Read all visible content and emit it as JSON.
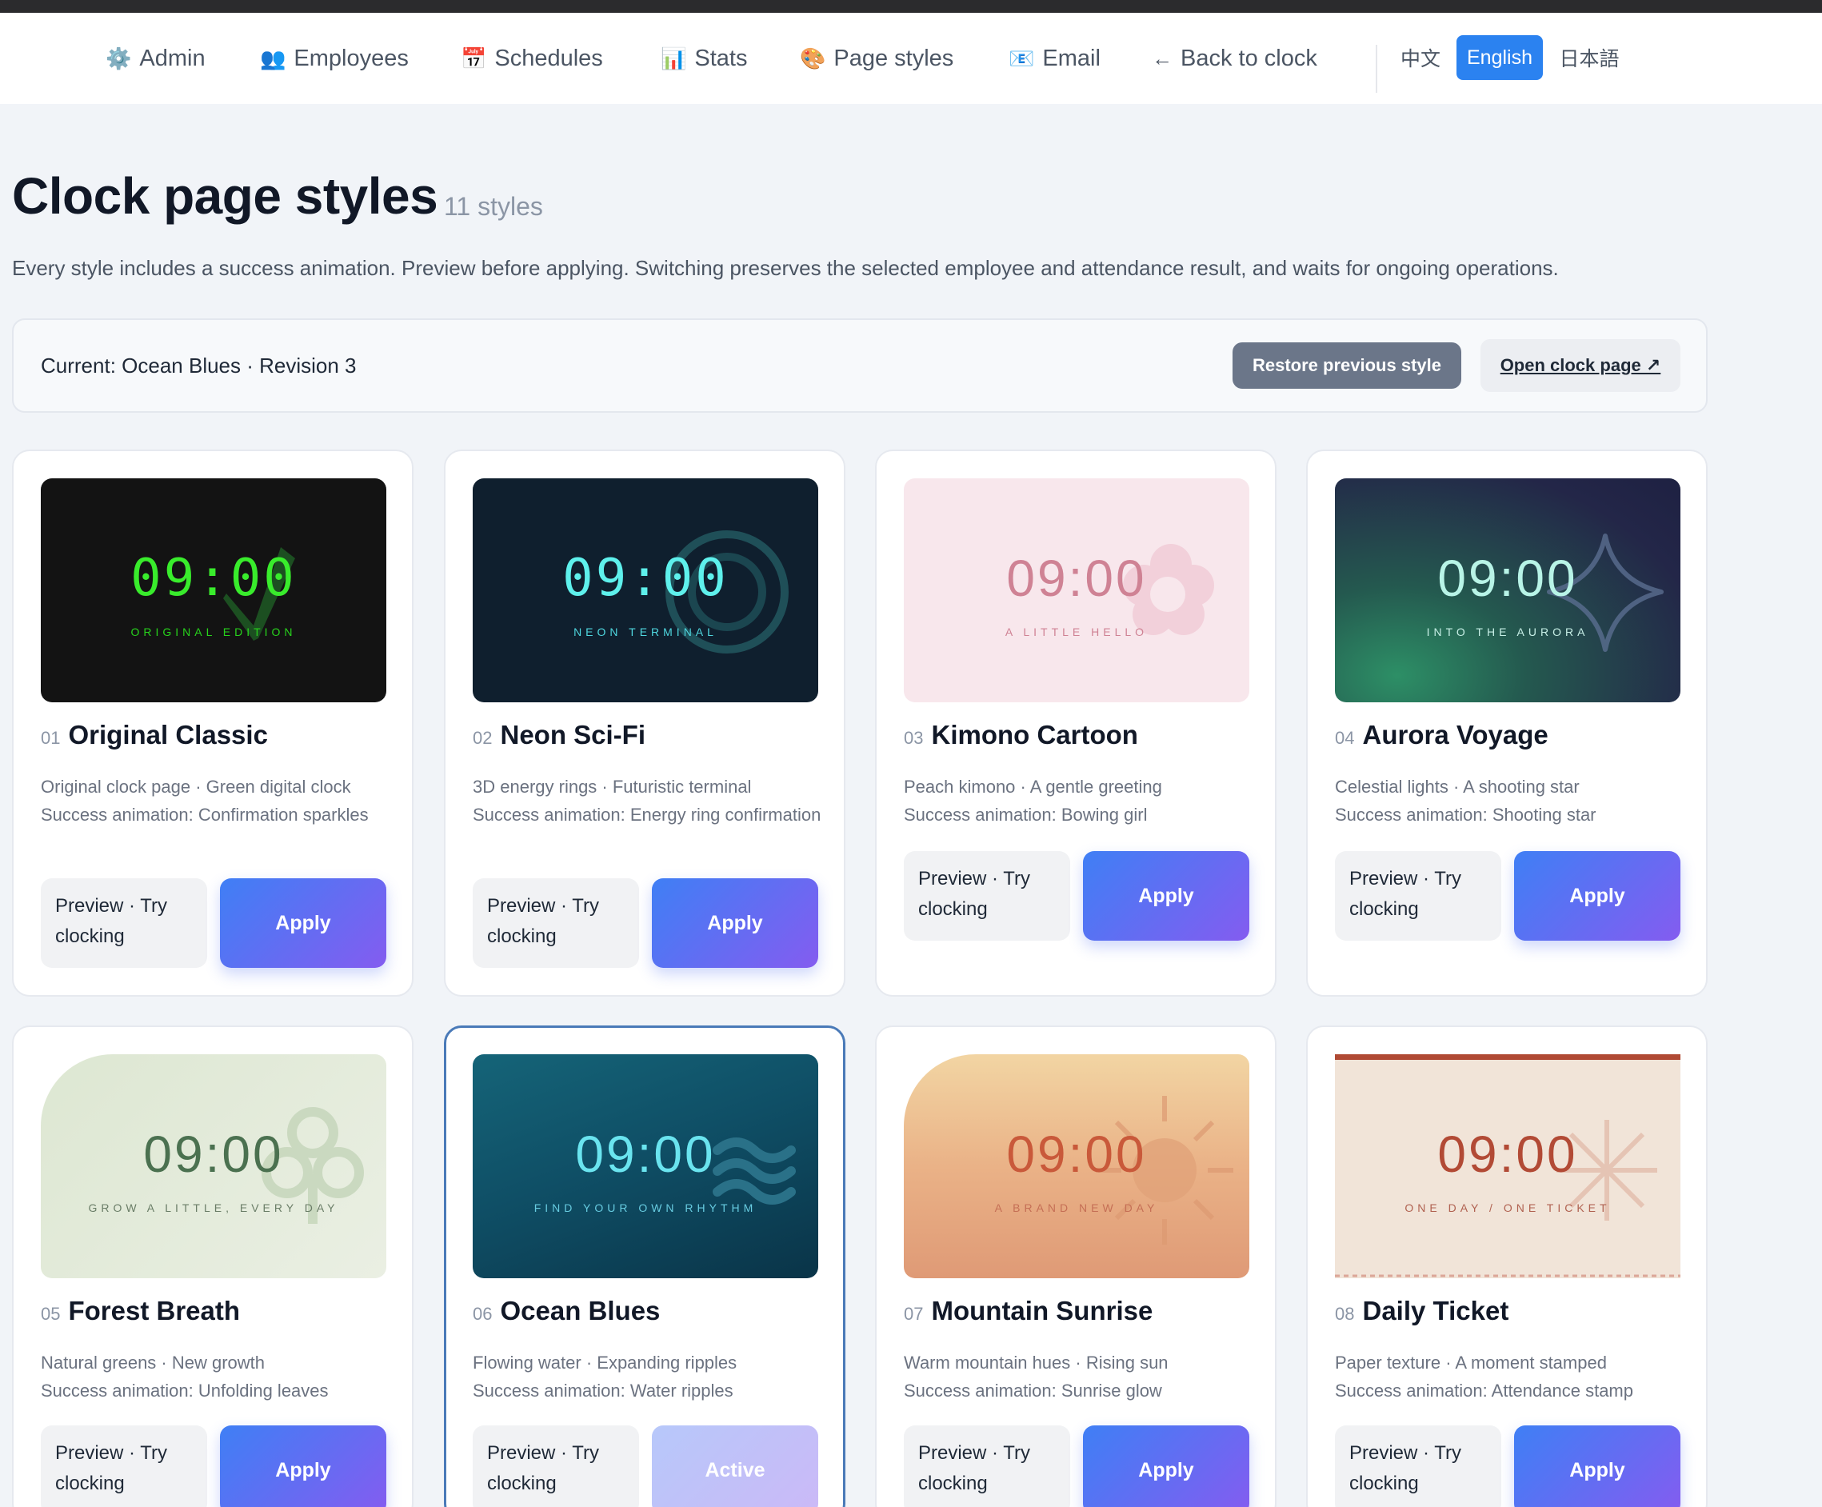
{
  "nav": {
    "items": [
      {
        "icon": "⚙️",
        "icon_name": "gear-icon",
        "label": "Admin"
      },
      {
        "icon": "👥",
        "icon_name": "users-icon",
        "label": "Employees"
      },
      {
        "icon": "📅",
        "icon_name": "calendar-icon",
        "label": "Schedules"
      },
      {
        "icon": "📊",
        "icon_name": "bar-chart-icon",
        "label": "Stats"
      },
      {
        "icon": "🎨",
        "icon_name": "palette-icon",
        "label": "Page styles"
      },
      {
        "icon": "📧",
        "icon_name": "email-icon",
        "label": "Email"
      },
      {
        "icon": "←",
        "icon_name": "arrow-left-icon",
        "label": "Back to clock"
      }
    ],
    "languages": [
      {
        "label": "中文",
        "active": false
      },
      {
        "label": "English",
        "active": true
      },
      {
        "label": "日本語",
        "active": false
      }
    ]
  },
  "page": {
    "title": "Clock page styles",
    "count": "11 styles",
    "description": "Every style includes a success animation. Preview before applying. Switching preserves the selected employee and attendance result, and waits for ongoing operations."
  },
  "current": {
    "text": "Current: Ocean Blues · Revision 3",
    "restore_label": "Restore previous style",
    "open_label": "Open clock page ↗"
  },
  "buttons": {
    "preview_label": "Preview · Try clocking",
    "apply_label": "Apply",
    "active_label": "Active"
  },
  "styles": [
    {
      "num": "01",
      "name": "Original Classic",
      "time": "09:00",
      "tagline": "ORIGINAL EDITION",
      "desc_line1": "Original clock page · Green digital clock",
      "desc_line2": "Success animation: Confirmation sparkles",
      "state": "apply"
    },
    {
      "num": "02",
      "name": "Neon Sci-Fi",
      "time": "09:00",
      "tagline": "NEON TERMINAL",
      "desc_line1": "3D energy rings · Futuristic terminal",
      "desc_line2": "Success animation: Energy ring confirmation",
      "state": "apply"
    },
    {
      "num": "03",
      "name": "Kimono Cartoon",
      "time": "09:00",
      "tagline": "A LITTLE HELLO",
      "desc_line1": "Peach kimono · A gentle greeting",
      "desc_line2": "Success animation: Bowing girl",
      "state": "apply"
    },
    {
      "num": "04",
      "name": "Aurora Voyage",
      "time": "09:00",
      "tagline": "INTO THE AURORA",
      "desc_line1": "Celestial lights · A shooting star",
      "desc_line2": "Success animation: Shooting star",
      "state": "apply"
    },
    {
      "num": "05",
      "name": "Forest Breath",
      "time": "09:00",
      "tagline": "GROW A LITTLE, EVERY DAY",
      "desc_line1": "Natural greens · New growth",
      "desc_line2": "Success animation: Unfolding leaves",
      "state": "apply"
    },
    {
      "num": "06",
      "name": "Ocean Blues",
      "time": "09:00",
      "tagline": "FIND YOUR OWN RHYTHM",
      "desc_line1": "Flowing water · Expanding ripples",
      "desc_line2": "Success animation: Water ripples",
      "state": "active"
    },
    {
      "num": "07",
      "name": "Mountain Sunrise",
      "time": "09:00",
      "tagline": "A BRAND NEW DAY",
      "desc_line1": "Warm mountain hues · Rising sun",
      "desc_line2": "Success animation: Sunrise glow",
      "state": "apply"
    },
    {
      "num": "08",
      "name": "Daily Ticket",
      "time": "09:00",
      "tagline": "ONE DAY / ONE TICKET",
      "desc_line1": "Paper texture · A moment stamped",
      "desc_line2": "Success animation: Attendance stamp",
      "state": "apply"
    }
  ],
  "colors": {
    "accent": "#2b82f0",
    "apply_gradient_start": "#3f7ff5",
    "apply_gradient_end": "#845cf0",
    "selected_border": "#4a7ab8"
  }
}
